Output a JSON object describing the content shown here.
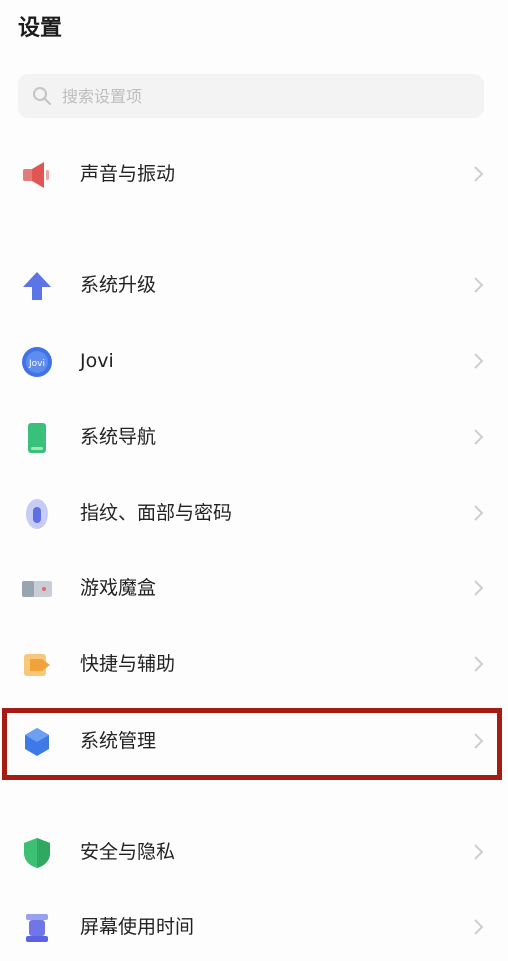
{
  "header": {
    "title": "设置"
  },
  "search": {
    "placeholder": "搜索设置项",
    "icon": "search-icon"
  },
  "items": [
    {
      "label": "声音与振动",
      "icon": "speaker-icon",
      "color": "#e05a5a"
    },
    {
      "label": "系统升级",
      "icon": "arrow-up-icon",
      "color": "#5b74e6"
    },
    {
      "label": "Jovi",
      "icon": "jovi-icon",
      "color": "#3f73e6"
    },
    {
      "label": "系统导航",
      "icon": "phone-icon",
      "color": "#39c07a"
    },
    {
      "label": "指纹、面部与密码",
      "icon": "fingerprint-icon",
      "color": "#5f6fe6"
    },
    {
      "label": "游戏魔盒",
      "icon": "gamebox-icon",
      "color": "#9aa3b0"
    },
    {
      "label": "快捷与辅助",
      "icon": "shortcut-icon",
      "color": "#f2a23a"
    },
    {
      "label": "系统管理",
      "icon": "shield-hexagon-icon",
      "color": "#3d7ae8"
    },
    {
      "label": "安全与隐私",
      "icon": "security-shield-icon",
      "color": "#3cc173"
    },
    {
      "label": "屏幕使用时间",
      "icon": "hourglass-icon",
      "color": "#5b63e0"
    }
  ],
  "highlight": {
    "item": "系统管理",
    "color": "#a51c14"
  }
}
